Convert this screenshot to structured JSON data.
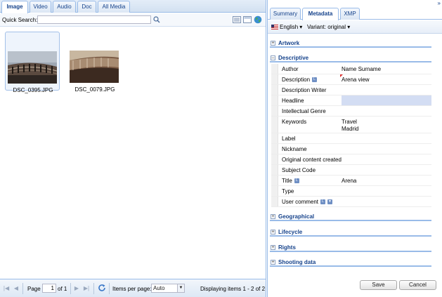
{
  "left": {
    "tabs": [
      "Image",
      "Video",
      "Audio",
      "Doc",
      "All Media"
    ],
    "active_tab": "Image",
    "quick_search": {
      "label": "Quick Search:",
      "value": ""
    },
    "thumbnails": [
      {
        "filename": "DSC_0395.JPG",
        "selected": true
      },
      {
        "filename": "DSC_0079.JPG",
        "selected": false
      }
    ],
    "pager": {
      "page_label": "Page",
      "page_value": "1",
      "of_label": "of 1",
      "items_per_page_label": "Items per page:",
      "items_per_page_value": "Auto",
      "display_text": "Displaying items 1 - 2 of 2"
    }
  },
  "right": {
    "collapse_icon": "double-chevron-right",
    "tabs": [
      "Summary",
      "Metadata",
      "XMP"
    ],
    "active_tab": "Metadata",
    "language": "English",
    "variant": "Variant: original",
    "sections": {
      "artwork": "Artwork",
      "descriptive": "Descriptive",
      "geographical": "Geographical",
      "lifecycle": "Lifecycle",
      "rights": "Rights",
      "shooting": "Shooting data"
    },
    "fields": [
      {
        "key": "Author",
        "value": "Name Surname"
      },
      {
        "key": "Description",
        "value": "Arena view"
      },
      {
        "key": "Description Writer",
        "value": ""
      },
      {
        "key": "Headline",
        "value": ""
      },
      {
        "key": "Intellectual Genre",
        "value": ""
      },
      {
        "key": "Keywords",
        "value": "Travel\nMadrid"
      },
      {
        "key": "Label",
        "value": ""
      },
      {
        "key": "Nickname",
        "value": ""
      },
      {
        "key": "Original content created",
        "value": ""
      },
      {
        "key": "Subject Code",
        "value": ""
      },
      {
        "key": "Title",
        "value": "Arena"
      },
      {
        "key": "Type",
        "value": ""
      },
      {
        "key": "User comment",
        "value": ""
      }
    ],
    "save_label": "Save",
    "cancel_label": "Cancel"
  },
  "colors": {
    "accent": "#15428b",
    "border": "#99bbe8",
    "edit_highlight": "#d3ddf3"
  }
}
